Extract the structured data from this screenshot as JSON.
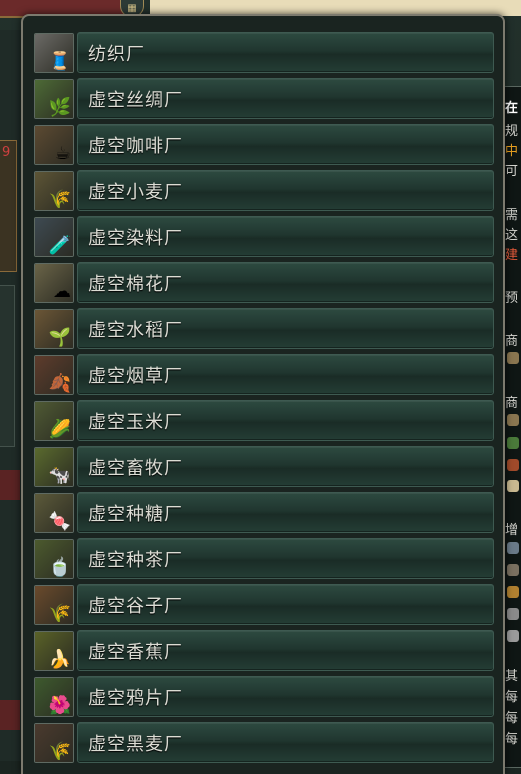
{
  "dropdown": {
    "items": [
      {
        "label": "纺织厂",
        "icon": "textile-mill-icon",
        "tint": "#6b6a66",
        "glyph": "🧵"
      },
      {
        "label": "虚空丝绸厂",
        "icon": "silk-plantation-icon",
        "tint": "#4d6a36",
        "glyph": "🌿"
      },
      {
        "label": "虚空咖啡厂",
        "icon": "coffee-plantation-icon",
        "tint": "#5c4a32",
        "glyph": "☕"
      },
      {
        "label": "虚空小麦厂",
        "icon": "wheat-farm-icon",
        "tint": "#5d5536",
        "glyph": "🌾"
      },
      {
        "label": "虚空染料厂",
        "icon": "dye-plantation-icon",
        "tint": "#3e4a52",
        "glyph": "🧪"
      },
      {
        "label": "虚空棉花厂",
        "icon": "cotton-plantation-icon",
        "tint": "#6a6448",
        "glyph": "☁"
      },
      {
        "label": "虚空水稻厂",
        "icon": "rice-farm-icon",
        "tint": "#6b5636",
        "glyph": "🌱"
      },
      {
        "label": "虚空烟草厂",
        "icon": "tobacco-plantation-icon",
        "tint": "#5e3c2c",
        "glyph": "🍂"
      },
      {
        "label": "虚空玉米厂",
        "icon": "maize-farm-icon",
        "tint": "#4f5a34",
        "glyph": "🌽"
      },
      {
        "label": "虚空畜牧厂",
        "icon": "livestock-ranch-icon",
        "tint": "#5a6a2e",
        "glyph": "🐄"
      },
      {
        "label": "虚空种糖厂",
        "icon": "sugar-plantation-icon",
        "tint": "#5c5a3a",
        "glyph": "🍬"
      },
      {
        "label": "虚空种茶厂",
        "icon": "tea-plantation-icon",
        "tint": "#4c5a2e",
        "glyph": "🍵"
      },
      {
        "label": "虚空谷子厂",
        "icon": "millet-farm-icon",
        "tint": "#6a4a2c",
        "glyph": "🌾"
      },
      {
        "label": "虚空香蕉厂",
        "icon": "banana-plantation-icon",
        "tint": "#5a6228",
        "glyph": "🍌"
      },
      {
        "label": "虚空鸦片厂",
        "icon": "opium-plantation-icon",
        "tint": "#3e5a2e",
        "glyph": "🌺"
      },
      {
        "label": "虚空黑麦厂",
        "icon": "rye-farm-icon",
        "tint": "#4a3a2e",
        "glyph": "🌾"
      }
    ]
  },
  "tooltip_fragments": {
    "line1": "在",
    "line2": "规",
    "line3": "中",
    "line4": "可",
    "line5": "需",
    "line6": "这",
    "line7": "建",
    "line8": "预",
    "line9": "商",
    "line10": "商",
    "line11": "增",
    "line12": "其",
    "line13": "每",
    "line14": "每",
    "line15": "每"
  },
  "background": {
    "left_card_digit": "9",
    "top_button_icon": "grid-icon"
  }
}
